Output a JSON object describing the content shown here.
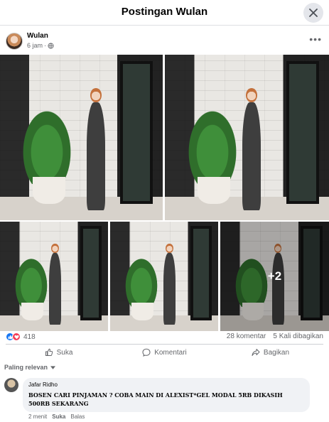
{
  "dialog": {
    "title": "Postingan Wulan"
  },
  "post": {
    "author": "Wulan",
    "time": "6 jam",
    "audience_icon": "globe-icon",
    "photos_more": "+2"
  },
  "stats": {
    "reaction_count": "418",
    "comments": "28 komentar",
    "shares": "5 Kali dibagikan"
  },
  "actions": {
    "like": "Suka",
    "comment": "Komentari",
    "share": "Bagikan"
  },
  "sort": {
    "label": "Paling relevan"
  },
  "comment": {
    "author": "Jafar Ridho",
    "text": "BOSEN CARI PINJAMAN ? COBA MAIN DI ALEXIST*GEL MODAL 5RB DIKASIH 500RB SEKARANG",
    "time": "2 menit",
    "like": "Suka",
    "reply": "Balas"
  },
  "colors": {
    "accent": "#1877f2",
    "love": "#f33e58",
    "secondary_text": "#65676b"
  }
}
